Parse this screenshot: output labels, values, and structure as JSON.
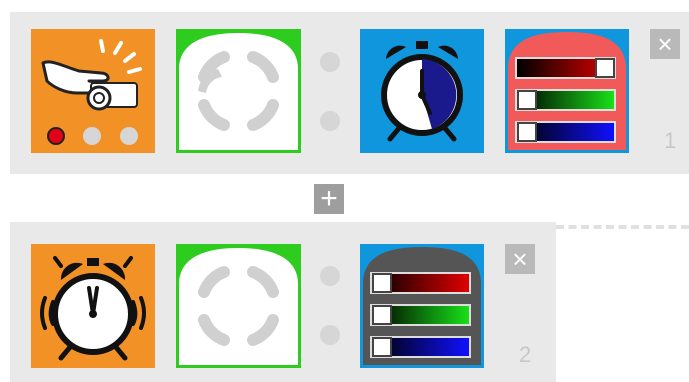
{
  "program": {
    "add_block_label": "+",
    "blocks": [
      {
        "number": "1",
        "close_label": "×",
        "event": "hand-wave-projector-icon",
        "action": "timer-clock-icon",
        "output": "rgb-color-sliders",
        "led_states": [
          "on",
          "off",
          "off"
        ],
        "rgb": [
          0.85,
          0.0,
          0.0
        ]
      },
      {
        "number": "2",
        "close_label": "×",
        "event": "alarm-clock-ringing-icon",
        "output": "rgb-color-sliders",
        "rgb": [
          0.0,
          0.0,
          0.0
        ]
      }
    ]
  },
  "colors": {
    "event_tile": "#f29126",
    "action_tile": "#1096dc",
    "condition_border": "#2ecc1e",
    "rgb_cap_1": "#f25a5a",
    "rgb_cap_2": "#555555",
    "led_on": "#e2001a",
    "led_off": "#d6d6d6"
  }
}
